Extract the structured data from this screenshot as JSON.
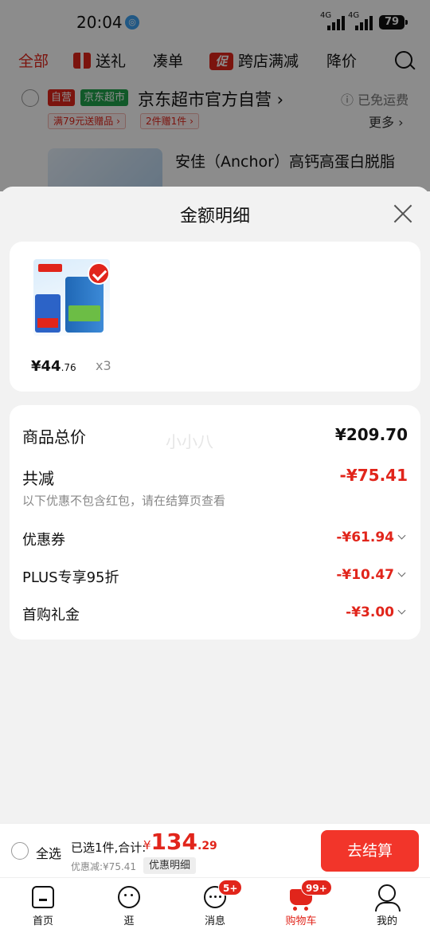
{
  "status_bar": {
    "time": "20:04",
    "net1": "4G",
    "net2": "4G",
    "battery": "79"
  },
  "filters": [
    {
      "label": "全部"
    },
    {
      "label": "送礼"
    },
    {
      "label": "凑单"
    },
    {
      "label": "跨店满减",
      "badge": "促"
    },
    {
      "label": "降价"
    }
  ],
  "store": {
    "tag_self": "自营",
    "tag_market": "京东超市",
    "name": "京东超市官方自营 ›",
    "free_shipping": "ⓘ 已免运费",
    "chip1": "满79元送赠品 ›",
    "chip2": "2件赠1件 ›",
    "more": "更多 ›",
    "product_title": "安佳（Anchor）高钙高蛋白脱脂"
  },
  "sheet": {
    "title": "金额明细",
    "product": {
      "price_main": "¥44",
      "price_dec": ".76",
      "qty": "x3"
    },
    "total_label": "商品总价",
    "total_value": "¥209.70",
    "watermark": "小小八",
    "reduce_label": "共减",
    "reduce_value": "-¥75.41",
    "reduce_note": "以下优惠不包含红包，请在结算页查看",
    "lines": [
      {
        "label": "优惠券",
        "value": "-¥61.94"
      },
      {
        "label": "PLUS专享95折",
        "value": "-¥10.47"
      },
      {
        "label": "首购礼金",
        "value": "-¥3.00"
      }
    ]
  },
  "checkout": {
    "select_all": "全选",
    "summary": "已选1件,合计:",
    "currency": "¥",
    "total_int": "134",
    "total_dec": ".29",
    "discount_line": "优惠减:¥75.41",
    "detail_button": "优惠明细",
    "pay_button": "去结算"
  },
  "tabbar": [
    {
      "label": "首页"
    },
    {
      "label": "逛"
    },
    {
      "label": "消息",
      "badge": "5+"
    },
    {
      "label": "购物车",
      "badge": "99+"
    },
    {
      "label": "我的"
    }
  ],
  "colors": {
    "accent": "#e1251b",
    "pay_button": "#f2352a",
    "market_tag": "#1fa24b"
  }
}
